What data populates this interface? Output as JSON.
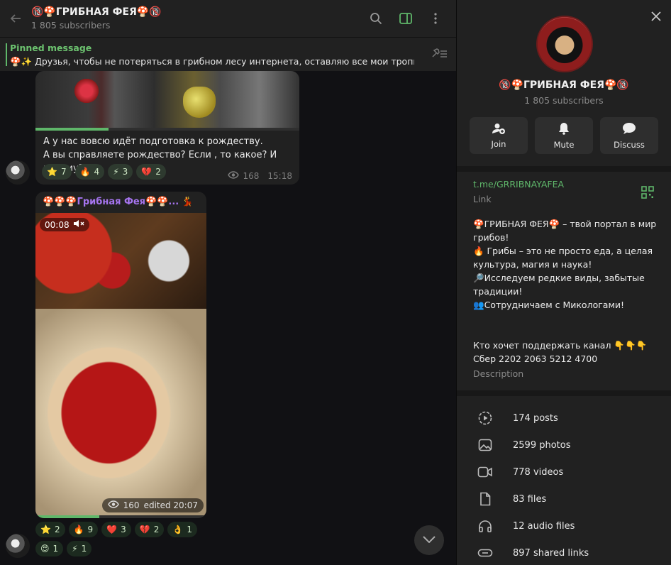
{
  "header": {
    "title": "🔞🍄ГРИБНАЯ ФЕЯ🍄🔞",
    "subscribers": "1 805 subscribers"
  },
  "pinned": {
    "title": "Pinned message",
    "text": "🍄✨ Друзья, чтобы не потеряться в грибном лесу интернета, оставляю все мои тропин..."
  },
  "post1": {
    "text_line1": "А у нас вовсю идёт подготовка к рождеству.",
    "text_line2": "А вы справляете рождество? Если , то какое? И почему?)",
    "reactions": [
      {
        "emoji": "⭐",
        "count": "7"
      },
      {
        "emoji": "🔥",
        "count": "4"
      },
      {
        "emoji": "⚡",
        "count": "3"
      },
      {
        "emoji": "💔",
        "count": "2"
      }
    ],
    "views": "168",
    "time": "15:18"
  },
  "post2": {
    "author": "🍄🍄🍄Грибная Фея🍄🍄...",
    "author_badge": "💃",
    "video_time": "00:08",
    "views": "160",
    "edited": "edited 20:07",
    "reactions_row1": [
      {
        "emoji": "⭐",
        "count": "2"
      },
      {
        "emoji": "🔥",
        "count": "9"
      },
      {
        "emoji": "❤️",
        "count": "3"
      },
      {
        "emoji": "💔",
        "count": "2"
      },
      {
        "emoji": "👌",
        "count": "1"
      }
    ],
    "reactions_row2": [
      {
        "emoji": "😍",
        "count": "1"
      },
      {
        "emoji": "⚡",
        "count": "1"
      }
    ]
  },
  "panel": {
    "name": "🔞🍄ГРИБНАЯ ФЕЯ🍄🔞",
    "subscribers": "1 805 subscribers",
    "actions": {
      "join": "Join",
      "mute": "Mute",
      "discuss": "Discuss"
    },
    "link": "t.me/GRRIBNAYAFEA",
    "link_label": "Link",
    "description": "🍄ГРИБНАЯ ФЕЯ🍄 – твой портал в мир грибов!\n🔥 Грибы – это не просто еда, а целая культура, магия и наука!\n🔎Исследуем редкие виды, забытые традиции!\n👥Сотрудничаем с Микологами!\n\n\nКто хочет поддержать канал 👇👇👇\n      Сбер      2202 2063 5212 4700",
    "description_label": "Description",
    "stats": [
      {
        "icon": "posts-icon",
        "label": "174 posts"
      },
      {
        "icon": "photos-icon",
        "label": "2599 photos"
      },
      {
        "icon": "videos-icon",
        "label": "778 videos"
      },
      {
        "icon": "files-icon",
        "label": "83 files"
      },
      {
        "icon": "audio-icon",
        "label": "12 audio files"
      },
      {
        "icon": "links-icon",
        "label": "897 shared links"
      }
    ]
  },
  "colors": {
    "accent": "#5fb76a",
    "author": "#a675f0",
    "panel_bg": "#212121",
    "chat_bg": "#111114"
  }
}
